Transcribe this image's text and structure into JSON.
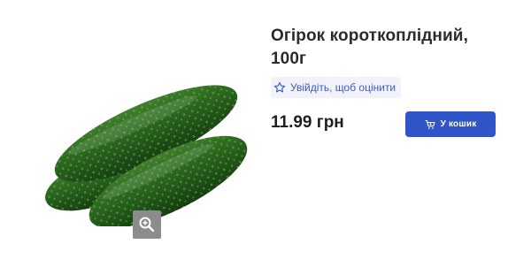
{
  "product": {
    "title_line1": "Огірок короткоплідний,",
    "title_line2": "100г",
    "image_alt": "cucumbers"
  },
  "rating": {
    "link_text": "Увійдіть, щоб оцінити",
    "icon": "star-outline-icon"
  },
  "price": {
    "text": "11.99 грн"
  },
  "cart_button": {
    "label": "У кошик",
    "icon": "cart-icon",
    "color": "#2f55c8"
  },
  "zoom_button": {
    "icon": "zoom-in-icon"
  }
}
